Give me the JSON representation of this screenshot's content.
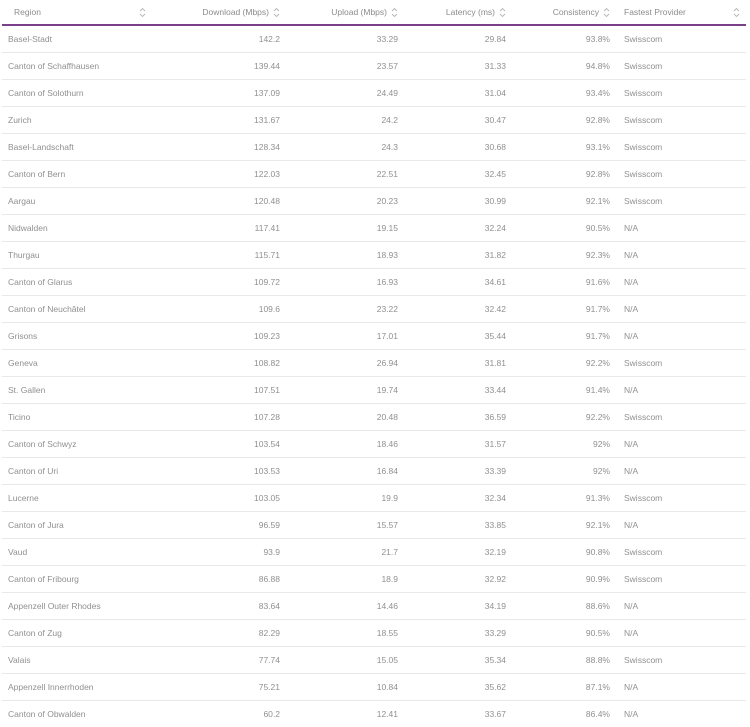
{
  "columns": [
    {
      "label": "Region"
    },
    {
      "label": "Download (Mbps)"
    },
    {
      "label": "Upload (Mbps)"
    },
    {
      "label": "Latency (ms)"
    },
    {
      "label": "Consistency"
    },
    {
      "label": "Fastest Provider"
    }
  ],
  "rows": [
    [
      "Basel-Stadt",
      "142.2",
      "33.29",
      "29.84",
      "93.8%",
      "Swisscom"
    ],
    [
      "Canton of Schaffhausen",
      "139.44",
      "23.57",
      "31.33",
      "94.8%",
      "Swisscom"
    ],
    [
      "Canton of Solothurn",
      "137.09",
      "24.49",
      "31.04",
      "93.4%",
      "Swisscom"
    ],
    [
      "Zurich",
      "131.67",
      "24.2",
      "30.47",
      "92.8%",
      "Swisscom"
    ],
    [
      "Basel-Landschaft",
      "128.34",
      "24.3",
      "30.68",
      "93.1%",
      "Swisscom"
    ],
    [
      "Canton of Bern",
      "122.03",
      "22.51",
      "32.45",
      "92.8%",
      "Swisscom"
    ],
    [
      "Aargau",
      "120.48",
      "20.23",
      "30.99",
      "92.1%",
      "Swisscom"
    ],
    [
      "Nidwalden",
      "117.41",
      "19.15",
      "32.24",
      "90.5%",
      "N/A"
    ],
    [
      "Thurgau",
      "115.71",
      "18.93",
      "31.82",
      "92.3%",
      "N/A"
    ],
    [
      "Canton of Glarus",
      "109.72",
      "16.93",
      "34.61",
      "91.6%",
      "N/A"
    ],
    [
      "Canton of Neuchâtel",
      "109.6",
      "23.22",
      "32.42",
      "91.7%",
      "N/A"
    ],
    [
      "Grisons",
      "109.23",
      "17.01",
      "35.44",
      "91.7%",
      "N/A"
    ],
    [
      "Geneva",
      "108.82",
      "26.94",
      "31.81",
      "92.2%",
      "Swisscom"
    ],
    [
      "St. Gallen",
      "107.51",
      "19.74",
      "33.44",
      "91.4%",
      "N/A"
    ],
    [
      "Ticino",
      "107.28",
      "20.48",
      "36.59",
      "92.2%",
      "Swisscom"
    ],
    [
      "Canton of Schwyz",
      "103.54",
      "18.46",
      "31.57",
      "92%",
      "N/A"
    ],
    [
      "Canton of Uri",
      "103.53",
      "16.84",
      "33.39",
      "92%",
      "N/A"
    ],
    [
      "Lucerne",
      "103.05",
      "19.9",
      "32.34",
      "91.3%",
      "Swisscom"
    ],
    [
      "Canton of Jura",
      "96.59",
      "15.57",
      "33.85",
      "92.1%",
      "N/A"
    ],
    [
      "Vaud",
      "93.9",
      "21.7",
      "32.19",
      "90.8%",
      "Swisscom"
    ],
    [
      "Canton of Fribourg",
      "86.88",
      "18.9",
      "32.92",
      "90.9%",
      "Swisscom"
    ],
    [
      "Appenzell Outer Rhodes",
      "83.64",
      "14.46",
      "34.19",
      "88.6%",
      "N/A"
    ],
    [
      "Canton of Zug",
      "82.29",
      "18.55",
      "33.29",
      "90.5%",
      "N/A"
    ],
    [
      "Valais",
      "77.74",
      "15.05",
      "35.34",
      "88.8%",
      "Swisscom"
    ],
    [
      "Appenzell Innerrhoden",
      "75.21",
      "10.84",
      "35.62",
      "87.1%",
      "N/A"
    ],
    [
      "Canton of Obwalden",
      "60.2",
      "12.41",
      "33.67",
      "86.4%",
      "N/A"
    ]
  ],
  "colors": {
    "header_rule": "#7b3f8c",
    "text": "#909090",
    "row_rule": "#e8e8e8"
  },
  "icons": {
    "sort": "sort-arrows-icon"
  }
}
